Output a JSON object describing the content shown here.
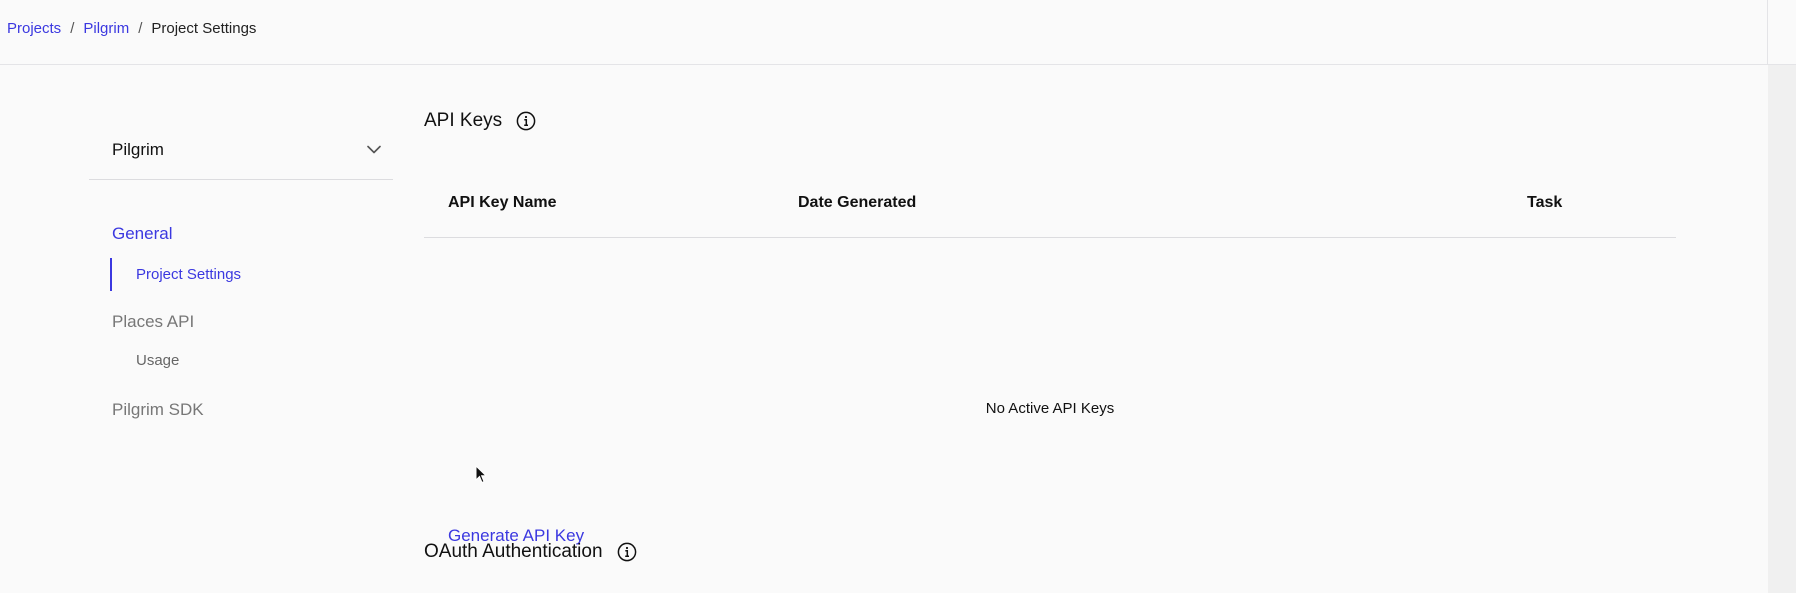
{
  "breadcrumb": {
    "items": [
      "Projects",
      "Pilgrim"
    ],
    "separator": "/",
    "current": "Project Settings"
  },
  "sidebar": {
    "project_select": {
      "value": "Pilgrim",
      "icon": "chevron-down-icon"
    },
    "sections": [
      {
        "label": "General",
        "active": true,
        "items": [
          {
            "label": "Project Settings",
            "active": true
          }
        ]
      },
      {
        "label": "Places API",
        "active": false,
        "items": [
          {
            "label": "Usage",
            "active": false
          }
        ]
      },
      {
        "label": "Pilgrim SDK",
        "active": false,
        "items": []
      }
    ]
  },
  "api_keys": {
    "title": "API Keys",
    "info_icon": "info-icon",
    "columns": [
      "API Key Name",
      "Date Generated",
      "Task"
    ],
    "rows": [],
    "empty_message": "No Active API Keys",
    "generate_label": "Generate API Key"
  },
  "oauth": {
    "title": "OAuth Authentication",
    "info_icon": "info-icon"
  },
  "colors": {
    "accent": "#3b38e0",
    "muted": "#777777",
    "background": "#fafafa",
    "divider": "#dcdcdf"
  }
}
